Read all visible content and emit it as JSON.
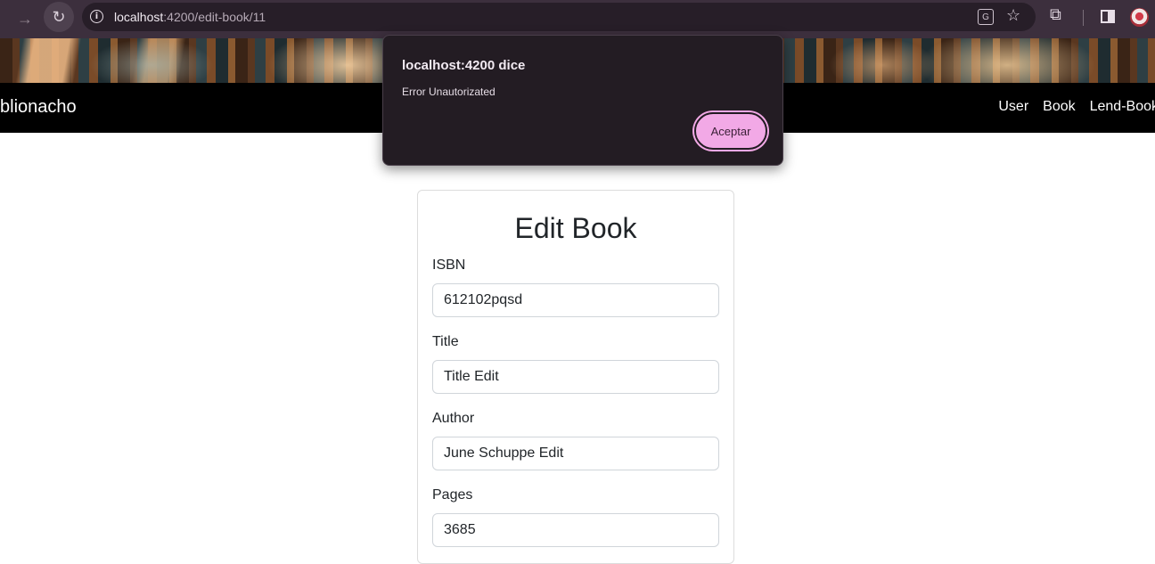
{
  "browser": {
    "url_host": "localhost",
    "url_rest": ":4200/edit-book/11"
  },
  "navbar": {
    "brand": "blionacho",
    "links": [
      "User",
      "Book",
      "Lend-Book"
    ]
  },
  "form": {
    "title": "Edit Book",
    "fields": [
      {
        "label": "ISBN",
        "value": "612102pqsd"
      },
      {
        "label": "Title",
        "value": "Title Edit"
      },
      {
        "label": "Author",
        "value": "June Schuppe Edit"
      },
      {
        "label": "Pages",
        "value": "3685"
      }
    ]
  },
  "dialog": {
    "title": "localhost:4200 dice",
    "message": "Error Unautorizated",
    "button": "Aceptar"
  }
}
